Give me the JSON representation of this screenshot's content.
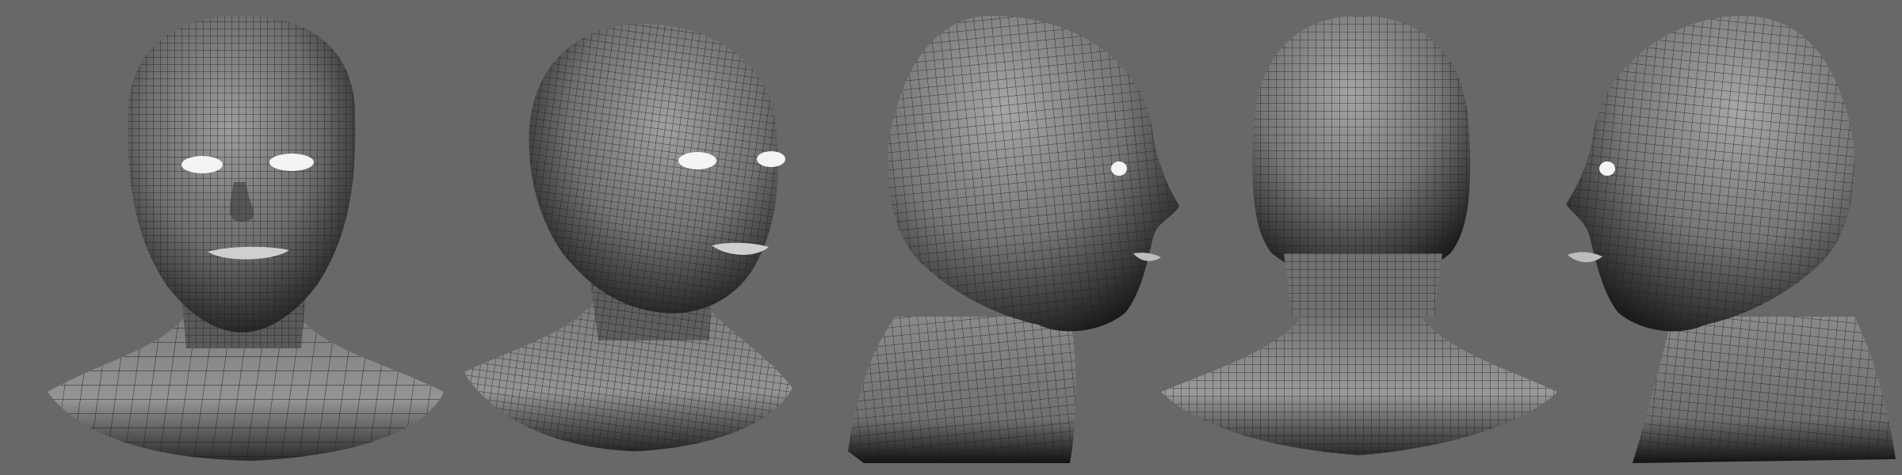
{
  "scene": {
    "background": "#686868",
    "mesh_color": "#1c1c1c",
    "shade_light": "#a9a9a9",
    "shade_dark": "#101010",
    "eye_color": "#f4f4f4",
    "views": [
      {
        "label": "front",
        "icon": "head-front-view"
      },
      {
        "label": "three-quarter",
        "icon": "head-three-quarter-view"
      },
      {
        "label": "side-right",
        "icon": "head-profile-right-view"
      },
      {
        "label": "back",
        "icon": "head-back-view"
      },
      {
        "label": "side-left",
        "icon": "head-profile-left-view"
      }
    ]
  }
}
